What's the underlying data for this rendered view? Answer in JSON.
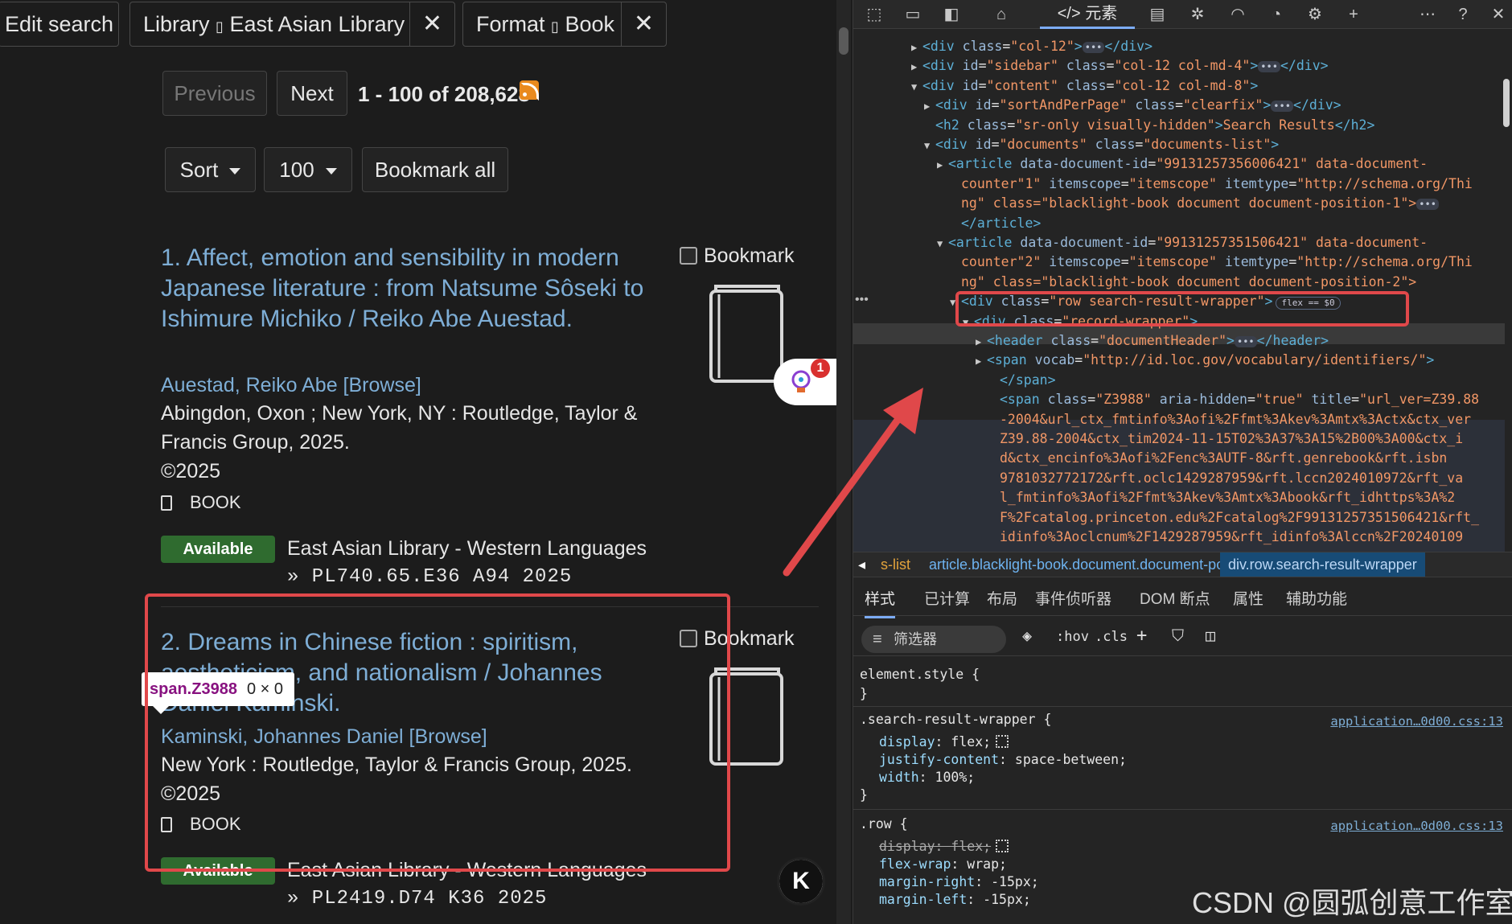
{
  "search_constraints": {
    "edit_label": "Edit search",
    "filters": [
      {
        "label": "Library",
        "sep": "▯",
        "value": "East Asian Library",
        "remove": "✕"
      },
      {
        "label": "Format",
        "sep": "▯",
        "value": "Book",
        "remove": "✕"
      }
    ]
  },
  "pager": {
    "previous": "Previous",
    "next": "Next",
    "range": "1 - 100 of 208,628"
  },
  "controls": {
    "sort": "Sort",
    "per_page": "100",
    "bookmark_all": "Bookmark all"
  },
  "results": [
    {
      "title": "1. Affect, emotion and sensibility in modern Japanese literature : from Natsume Sôseki to Ishimure Michiko / Reiko Abe Auestad.",
      "author": "Auestad, Reiko Abe [Browse]",
      "publisher": "Abingdon, Oxon ; New York, NY : Routledge, Taylor & Francis Group, 2025.",
      "copyright": "©2025",
      "format": "BOOK",
      "status": "Available",
      "location": "East Asian Library - Western Languages",
      "call_number": "» PL740.65.E36 A94 2025",
      "bookmark": "Bookmark"
    },
    {
      "title": "2. Dreams in Chinese fiction : spiritism, aestheticism, and nationalism / Johannes Daniel Kaminski.",
      "author": "Kaminski, Johannes Daniel [Browse]",
      "publisher": "New York : Routledge, Taylor & Francis Group, 2025.",
      "copyright": "©2025",
      "format": "BOOK",
      "status": "Available",
      "location": "East Asian Library - Western Languages",
      "call_number": "» PL2419.D74 K36 2025",
      "bookmark": "Bookmark"
    }
  ],
  "inspect_tooltip": {
    "tag": "span.Z3988",
    "dims": "0 × 0"
  },
  "assistant_badge": "1",
  "k_button": "K",
  "devtools": {
    "toolbar_tab": "</> 元素",
    "dom_lines": [
      {
        "ind": 5,
        "tri": "▶",
        "html": "<div class=\"col-12\">",
        "tail": "</div>"
      },
      {
        "ind": 5,
        "tri": "▶",
        "html": "<div id=\"sidebar\" class=\"col-12 col-md-4\">",
        "tail": "</div>"
      },
      {
        "ind": 5,
        "tri": "▼",
        "html": "<div id=\"content\" class=\"col-12 col-md-8\">",
        "tail": ""
      },
      {
        "ind": 6,
        "tri": "▶",
        "html": "<div id=\"sortAndPerPage\" class=\"clearfix\">",
        "tail": "</div>"
      },
      {
        "ind": 6,
        "tri": "",
        "html": "<h2 class=\"sr-only visually-hidden\">Search Results</h2>",
        "tail": ""
      },
      {
        "ind": 6,
        "tri": "▼",
        "html": "<div id=\"documents\" class=\"documents-list\">",
        "tail": ""
      },
      {
        "ind": 7,
        "tri": "▶",
        "html": "<article data-document-id=\"99131257356006421\" data-document-",
        "tail": ""
      },
      {
        "ind": 8,
        "tri": "",
        "html": "counter=\"1\" itemscope=\"itemscope\" itemtype=\"http://schema.org/Thi",
        "tail": ""
      },
      {
        "ind": 8,
        "tri": "",
        "html": "ng\" class=\"blacklight-book document document-position-1\">",
        "tail": "…"
      },
      {
        "ind": 8,
        "tri": "",
        "html": "</article>",
        "tail": ""
      },
      {
        "ind": 7,
        "tri": "▼",
        "html": "<article data-document-id=\"99131257351506421\" data-document-",
        "tail": ""
      },
      {
        "ind": 8,
        "tri": "",
        "html": "counter=\"2\" itemscope=\"itemscope\" itemtype=\"http://schema.org/Thi",
        "tail": ""
      },
      {
        "ind": 8,
        "tri": "",
        "html": "ng\" class=\"blacklight-book document document-position-2\">",
        "tail": ""
      },
      {
        "ind": 8,
        "tri": "▼",
        "html": "<div class=\"row search-result-wrapper\">",
        "tail": "flex == $0"
      },
      {
        "ind": 9,
        "tri": "▼",
        "html": "<div class=\"record-wrapper\">",
        "tail": ""
      },
      {
        "ind": 10,
        "tri": "▶",
        "html": "<header class=\"documentHeader\">",
        "tail": "</header>"
      },
      {
        "ind": 10,
        "tri": "▶",
        "html": "<span vocab=\"http://id.loc.gov/vocabulary/identifiers/\">",
        "tail": ""
      },
      {
        "ind": 11,
        "tri": "",
        "html": "</span>",
        "tail": ""
      },
      {
        "ind": 11,
        "tri": "",
        "html": "<span class=\"Z3988\" aria-hidden=\"true\" title=\"url_ver=Z39.88",
        "tail": ""
      },
      {
        "ind": 11,
        "tri": "",
        "html": "-2004&url_ctx_fmt=info%3Aofi%2Ffmt%3Akev%3Amtx%3Actx&ctx_ver",
        "tail": ""
      },
      {
        "ind": 11,
        "tri": "",
        "html": "=Z39.88-2004&ctx_tim=2024-11-15T02%3A37%3A15%2B00%3A00&ctx_i",
        "tail": ""
      },
      {
        "ind": 11,
        "tri": "",
        "html": "d=&ctx_enc=info%3Aofi%2Fenc%3AUTF-8&rft.genre=book&rft.isbn=",
        "tail": ""
      },
      {
        "ind": 11,
        "tri": "",
        "html": "9781032772172&rft.oclc=1429287959&rft.lccn=2024010972&rft_va",
        "tail": ""
      },
      {
        "ind": 11,
        "tri": "",
        "html": "l_fmt=info%3Aofi%2Ffmt%3Akev%3Amtx%3Abook&rft_id=https%3A%2",
        "tail": ""
      },
      {
        "ind": 11,
        "tri": "",
        "html": "F%2Fcatalog.princeton.edu%2Fcatalog%2F99131257351506421&rft_",
        "tail": ""
      },
      {
        "ind": 11,
        "tri": "",
        "html": "id=info%3Aoclcnum%2F1429287959&rft_id=info%3Alccn%2F20240109",
        "tail": ""
      }
    ],
    "breadcrumbs": [
      "s-list",
      "article.blacklight-book.document.document-position-2",
      "div.row.search-result-wrapper"
    ],
    "subtabs": [
      "样式",
      "已计算",
      "布局",
      "事件侦听器",
      "DOM 断点",
      "属性",
      "辅助功能"
    ],
    "filter_placeholder": "筛选器",
    "filter_tools": [
      ":hov",
      ".cls"
    ],
    "styles": {
      "element_style": "element.style {",
      "close": "}",
      "rule1_selector": ".search-result-wrapper {",
      "rule1_source": "application…0d00.css:13",
      "rule1_props": [
        {
          "name": "display",
          "value": "flex;",
          "grid": true
        },
        {
          "name": "justify-content",
          "value": "space-between;"
        },
        {
          "name": "width",
          "value": "100%;"
        }
      ],
      "rule2_selector": ".row {",
      "rule2_source": "application…0d00.css:13",
      "rule2_props": [
        {
          "name": "display",
          "value": "flex;",
          "strike": true,
          "grid": true
        },
        {
          "name": "flex-wrap",
          "value": "wrap;"
        },
        {
          "name": "margin-right",
          "value": "-15px;"
        },
        {
          "name": "margin-left",
          "value": "-15px;"
        }
      ]
    }
  },
  "watermark": "CSDN @圆弧创意工作室",
  "colors": {
    "accent_link": "#7eaed6",
    "available": "#2f6b2f",
    "annotation_red": "#e0484a"
  }
}
